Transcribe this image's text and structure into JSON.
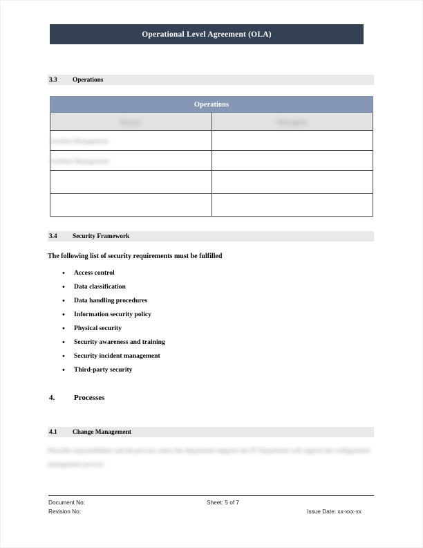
{
  "document": {
    "title": "Operational Level Agreement (OLA)",
    "colors": {
      "title_banner": "#344154",
      "table_title": "#8597b5",
      "section_bar": "#e9e9e9",
      "table_header": "#e2e2e2",
      "page_background": "#ffffff",
      "text": "#000000"
    }
  },
  "sections": {
    "operations": {
      "number": "3.3",
      "name": "Operations"
    },
    "security_framework": {
      "number": "3.4",
      "name": "Security Framework",
      "intro": "The following list of security requirements must be fulfilled",
      "requirements": [
        "Access control",
        "Data classification",
        "Data handling procedures",
        "Information security policy",
        "Physical security",
        "Security awareness and training",
        "Security incident management",
        "Third-party security"
      ],
      "bullet_glyph": "•"
    },
    "processes": {
      "number": "4.",
      "name": "Processes"
    },
    "change_management": {
      "number": "4.1",
      "name": "Change Management",
      "body_blurred": "Describe responsibilities and the process where the department supports the IT Department will support the configuration management process."
    }
  },
  "operations_table": {
    "title": "Operations",
    "columns": [
      "Process",
      "Description"
    ],
    "rows": [
      {
        "process": "Incident Management",
        "description": ""
      },
      {
        "process": "Problem Management",
        "description": ""
      },
      {
        "process": "",
        "description": ""
      },
      {
        "process": "",
        "description": ""
      }
    ]
  },
  "footer": {
    "document_no_label": "Document No:",
    "revision_no_label": "Revision No:",
    "sheet": "Sheet: 5 of 7",
    "issue_date": "Issue Date: xx-xxx-xx"
  }
}
